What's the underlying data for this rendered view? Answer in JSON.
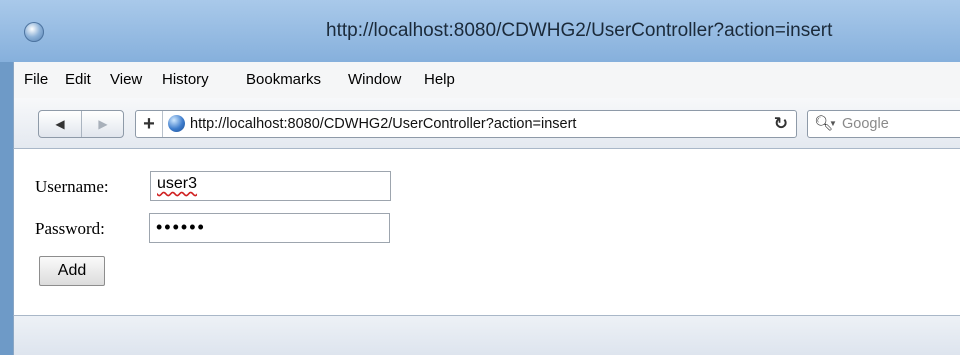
{
  "window": {
    "title": "http://localhost:8080/CDWHG2/UserController?action=insert"
  },
  "menu": {
    "items": [
      "File",
      "Edit",
      "View",
      "History",
      "Bookmarks",
      "Window",
      "Help"
    ]
  },
  "toolbar": {
    "back_icon": "◀",
    "forward_icon": "▶",
    "plus_icon": "+",
    "url": "http://localhost:8080/CDWHG2/UserController?action=insert",
    "reload_icon": "↻",
    "search_placeholder": "Google"
  },
  "form": {
    "username_label": "Username:",
    "username_value": "user3",
    "password_label": "Password:",
    "password_mask": "••••••",
    "add_label": "Add"
  },
  "colors": {
    "titlebar": "#8fb5df",
    "accent": "#3d7ccc"
  }
}
